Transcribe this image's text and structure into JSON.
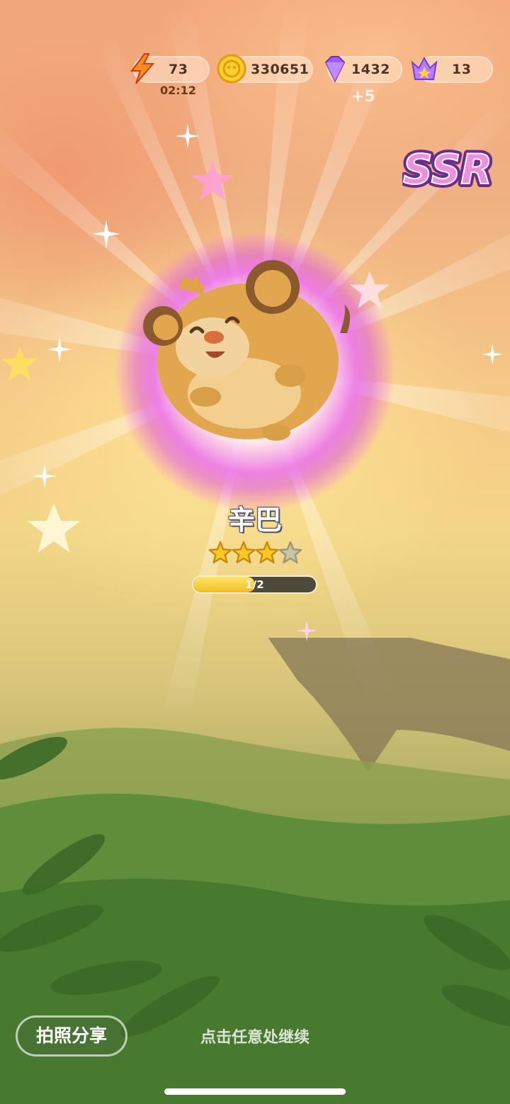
{
  "hud": {
    "energy": {
      "value": "73",
      "timer": "02:12",
      "icon": "lightning-icon"
    },
    "coins": {
      "value": "330651",
      "icon": "coin-icon"
    },
    "gems": {
      "value": "1432",
      "bonus": "+5",
      "icon": "gem-icon"
    },
    "crowns": {
      "value": "13",
      "icon": "crown-icon"
    }
  },
  "rarity": "SSR",
  "character": {
    "name": "辛巴",
    "stars_filled": 3,
    "stars_total": 4
  },
  "progress": {
    "label": "1/2",
    "fraction": 0.5
  },
  "buttons": {
    "share_label": "拍照分享"
  },
  "hint": "点击任意处继续",
  "colors": {
    "rarity_pink": "#e86ad9",
    "star_gold": "#f6c824",
    "progress_fill": "#f2c94a"
  }
}
